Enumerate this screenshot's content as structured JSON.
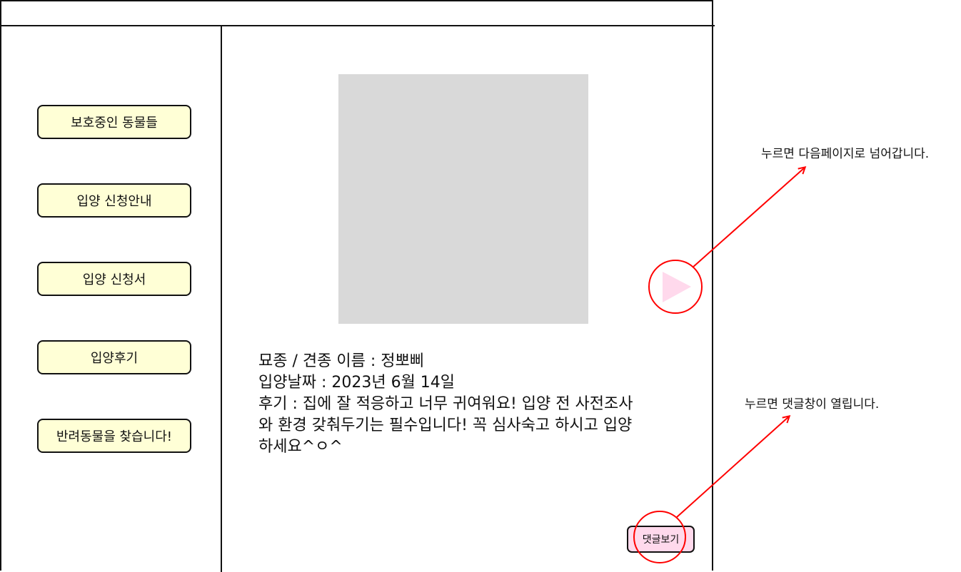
{
  "sidebar": {
    "items": [
      {
        "label": "보호중인 동물들"
      },
      {
        "label": "입양 신청안내"
      },
      {
        "label": "입양 신청서"
      },
      {
        "label": "입양후기"
      },
      {
        "label": "반려동물을 찾습니다!"
      }
    ]
  },
  "post": {
    "line1": "묘종 / 견종 이름 : 정뽀삐",
    "line2": "입양날짜 : 2023년 6월 14일",
    "line3": "후기 : 집에 잘 적응하고 너무 귀여워요! 입양 전 사전조사",
    "line4": "와 환경 갖춰두기는 필수입니다! 꼭 심사숙고 하시고 입양",
    "line5": "하세요^ㅇ^"
  },
  "comment_button_label": "댓글보기",
  "annotations": {
    "next_page_note": "누르면 다음페이지로 넘어갑니다.",
    "comment_note": "누르면 댓글창이 열립니다."
  },
  "colors": {
    "nav_button_bg": "#ffffd6",
    "comment_button_bg": "#ffd9ec",
    "photo_placeholder": "#d9d9d9",
    "annotation_red": "#ff0000",
    "play_triangle": "#ffd9ec"
  },
  "icons": {
    "next_button": "play-triangle-icon"
  }
}
